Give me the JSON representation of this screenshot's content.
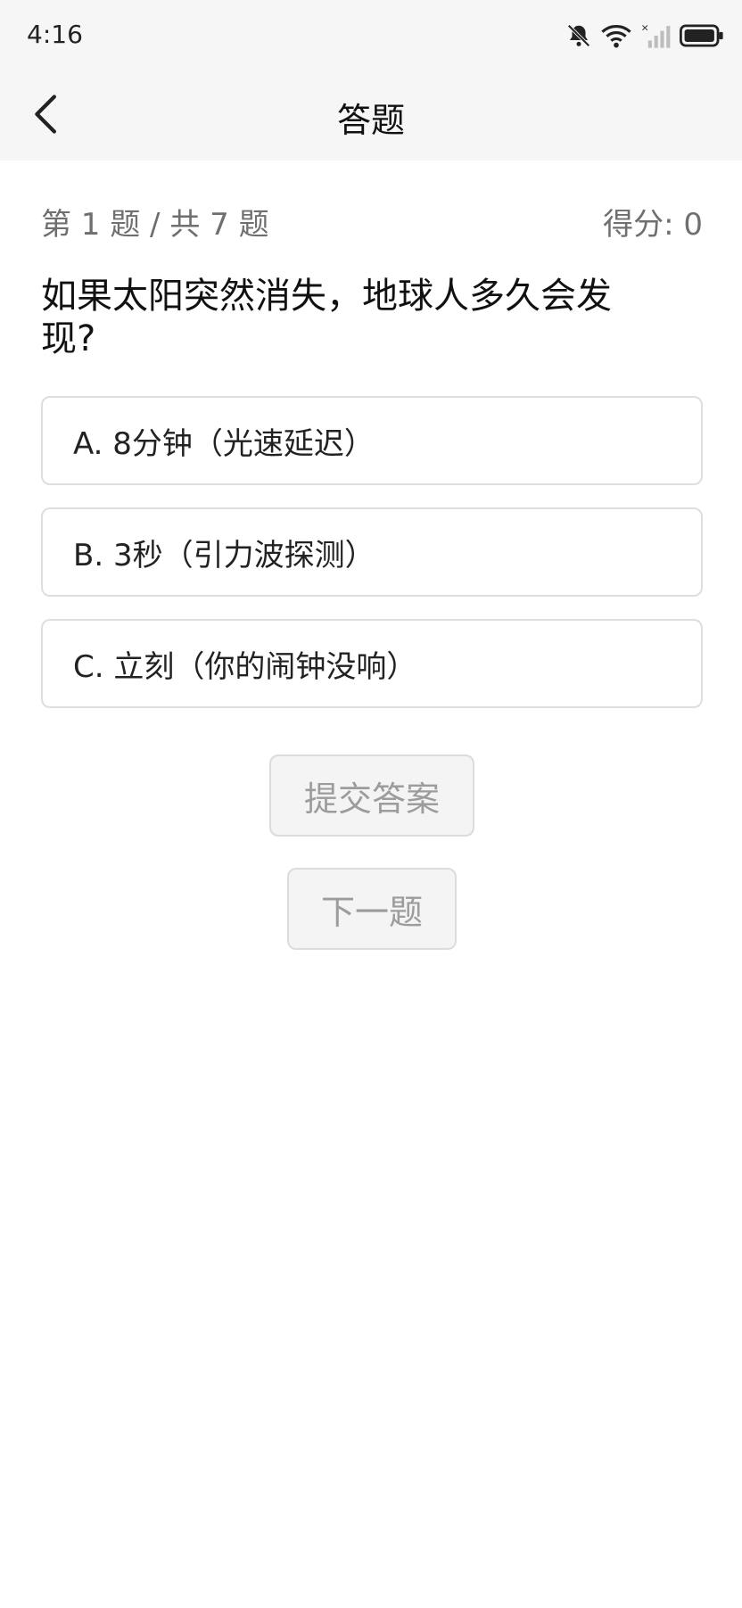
{
  "status_bar": {
    "time": "4:16",
    "icons": [
      "bell-off-icon",
      "wifi-icon",
      "signal-icon",
      "battery-icon"
    ]
  },
  "header": {
    "title": "答题",
    "back_icon": "chevron-left-icon"
  },
  "quiz": {
    "progress": "第 1 题 / 共 7 题",
    "score": "得分: 0",
    "question": "如果太阳突然消失，地球人多久会发现?",
    "options": [
      "A. 8分钟（光速延迟）",
      "B. 3秒（引力波探测）",
      "C. 立刻（你的闹钟没响）"
    ],
    "submit_label": "提交答案",
    "next_label": "下一题"
  },
  "colors": {
    "bar_background": "#f6f6f6",
    "meta_text": "#6f6f6f",
    "option_border": "#dedede",
    "disabled_button_bg": "#f4f4f4",
    "disabled_button_text": "#9c9c9c"
  }
}
